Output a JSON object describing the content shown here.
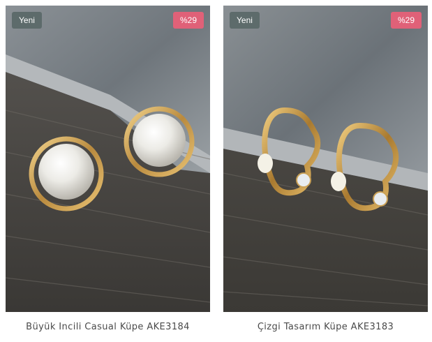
{
  "products": [
    {
      "title": "Büyük Incili Casual Küpe AKE3184",
      "badge_new": "Yeni",
      "badge_discount": "%29",
      "image": "pearl-stud-earrings-photo"
    },
    {
      "title": "Çizgi Tasarım Küpe AKE3183",
      "badge_new": "Yeni",
      "badge_discount": "%29",
      "image": "gold-heart-outline-earrings-photo"
    }
  ],
  "colors": {
    "badge_new_bg": "#5d6b6b",
    "badge_discount_bg": "#e06178",
    "title_text": "#4a4a4a"
  }
}
